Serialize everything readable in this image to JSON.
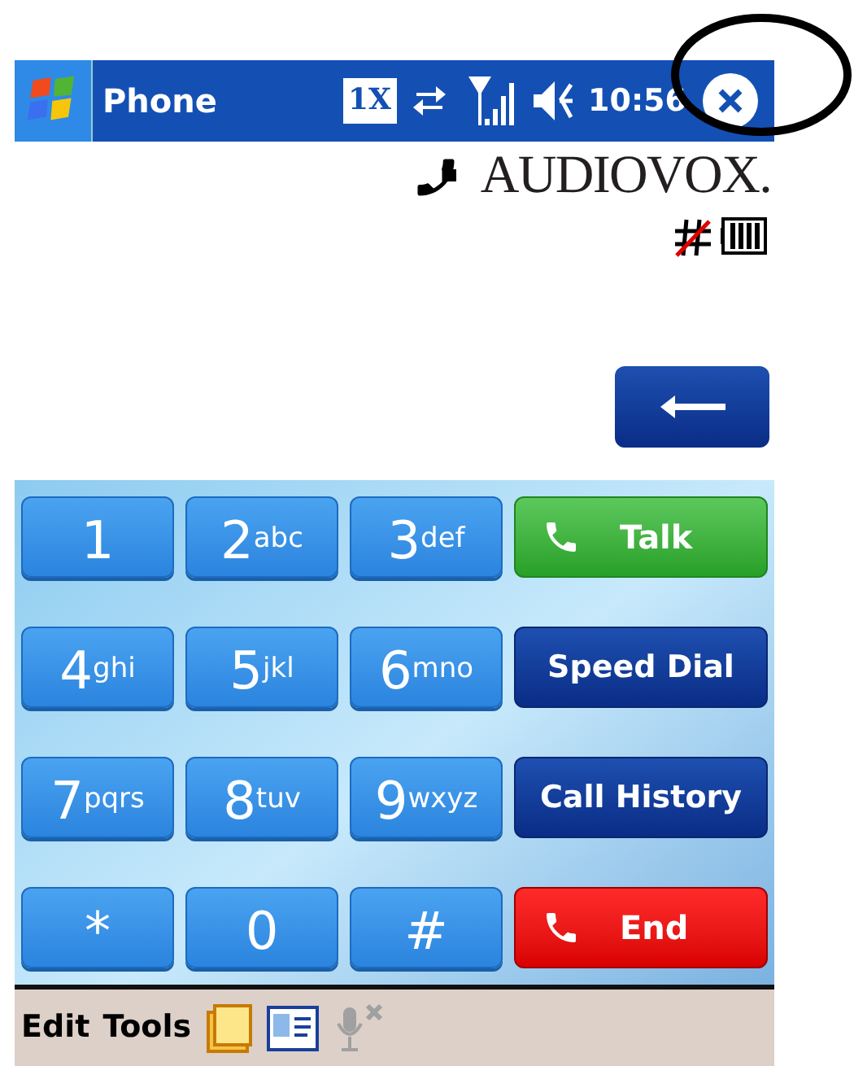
{
  "title_bar": {
    "title": "Phone",
    "network": "1X",
    "time": "10:56"
  },
  "brand": {
    "logo": "AUDIOVOX."
  },
  "keys": [
    {
      "kind": "digit",
      "digit": "1"
    },
    {
      "kind": "digit",
      "digit": "2",
      "letters": "abc"
    },
    {
      "kind": "digit",
      "digit": "3",
      "letters": "def"
    },
    {
      "kind": "talk",
      "label": "Talk"
    },
    {
      "kind": "digit",
      "digit": "4",
      "letters": "ghi"
    },
    {
      "kind": "digit",
      "digit": "5",
      "letters": "jkl"
    },
    {
      "kind": "digit",
      "digit": "6",
      "letters": "mno"
    },
    {
      "kind": "nav",
      "label": "Speed Dial"
    },
    {
      "kind": "digit",
      "digit": "7",
      "letters": "pqrs"
    },
    {
      "kind": "digit",
      "digit": "8",
      "letters": "tuv"
    },
    {
      "kind": "digit",
      "digit": "9",
      "letters": "wxyz"
    },
    {
      "kind": "nav",
      "label": "Call History"
    },
    {
      "kind": "digit",
      "digit": "*"
    },
    {
      "kind": "digit",
      "digit": "0"
    },
    {
      "kind": "digit",
      "digit": "#"
    },
    {
      "kind": "end",
      "label": "End"
    }
  ],
  "menu_bar": {
    "items": [
      "Edit",
      "Tools"
    ]
  }
}
